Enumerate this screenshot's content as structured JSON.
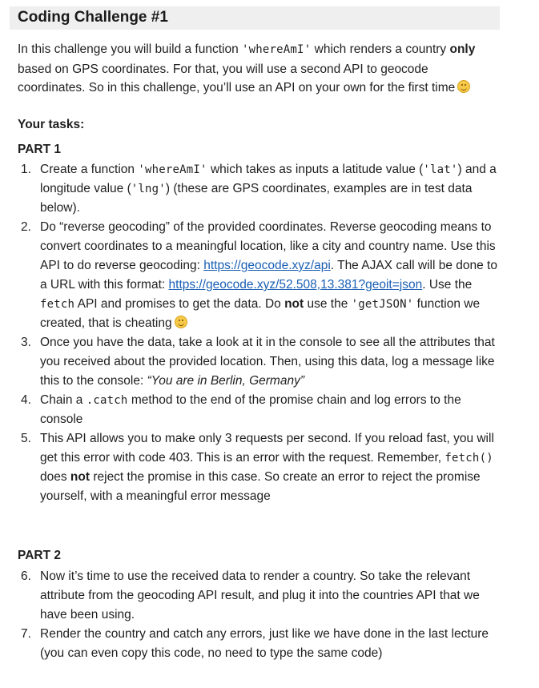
{
  "title": "Coding Challenge #1",
  "intro": {
    "t1": "In this challenge you will build a function ",
    "code1": "'whereAmI'",
    "t2": " which renders a country ",
    "bold": "only",
    "t3": " based on GPS coordinates. For that, you will use a second API to geocode coordinates. So in this challenge, you’ll use an API on your own for the first time",
    "emoji": "grinning-face-emoji"
  },
  "tasks_label": "Your tasks:",
  "part1_label": "PART 1",
  "part2_label": "PART 2",
  "part1": [
    {
      "num": "1.",
      "t1": "Create a function ",
      "code1": "'whereAmI'",
      "t2": " which takes as inputs a latitude value (",
      "code2": "'lat'",
      "t3": ") and a longitude value (",
      "code3": "'lng'",
      "t4": ") (these are GPS coordinates, examples are in test data below)."
    },
    {
      "num": "2.",
      "t1": "Do “reverse geocoding” of the provided coordinates. Reverse geocoding means to convert coordinates to a meaningful location, like a city and country name. Use this API to do reverse geocoding: ",
      "link1": "https://geocode.xyz/api",
      "t2": ". The AJAX call will be done to a URL with this format: ",
      "link2": "https://geocode.xyz/52.508,13.381?geoit=json",
      "t3": ". Use the ",
      "code1": "fetch",
      "t4": " API and promises to get the data. Do ",
      "bold": "not",
      "t5": " use the ",
      "code2": "'getJSON'",
      "t6": " function we created, that is cheating",
      "emoji": "winking-face-emoji"
    },
    {
      "num": "3.",
      "t1": "Once you have the data, take a look at it in the console to see all the attributes that you received about the provided location. Then, using this data, log a message like this to the console: ",
      "italic": "“You are in Berlin, Germany”"
    },
    {
      "num": "4.",
      "t1": "Chain a ",
      "code1": ".catch",
      "t2": " method to the end of the promise chain and log errors to the console"
    },
    {
      "num": "5.",
      "t1": "This API allows you to make only 3 requests per second. If you reload fast, you will get this error with code 403. This is an error with the request. Remember, ",
      "code1": "fetch()",
      "t2": " does ",
      "bold": "not",
      "t3": " reject the promise in this case. So create an error to reject the promise yourself, with a meaningful error message"
    }
  ],
  "part2": [
    {
      "num": "6.",
      "t1": "Now it’s time to use the received data to render a country. So take the relevant attribute from the geocoding API result, and plug it into the countries API that we have been using."
    },
    {
      "num": "7.",
      "t1": "Render the country and catch any errors, just like we have done in the last lecture (you can even copy this code, no need to type the same code)"
    }
  ]
}
